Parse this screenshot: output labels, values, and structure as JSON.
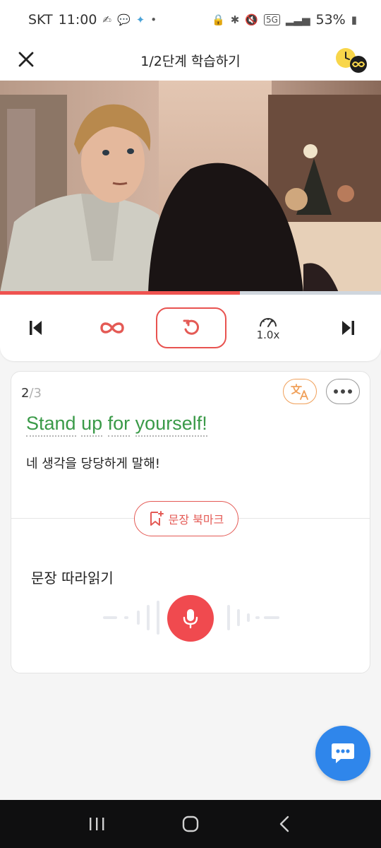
{
  "status_bar": {
    "carrier": "SKT",
    "time": "11:00",
    "battery": "53%",
    "network": "5G",
    "left_icons": [
      "hand-icon",
      "chat-bubble-icon",
      "sparkle-icon",
      "dot-icon"
    ],
    "right_icons": [
      "lock-icon",
      "bluetooth-icon",
      "mute-icon",
      "signal-icon",
      "battery-icon"
    ]
  },
  "header": {
    "title": "1/2단계 학습하기",
    "close_icon": "close-icon",
    "badge_icon": "timer-infinity-icon"
  },
  "video": {
    "progress": 0.63,
    "scene": "two people in an office"
  },
  "controls": {
    "prev_icon": "skip-previous-icon",
    "loop_icon": "infinity-icon",
    "replay_icon": "replay-icon",
    "speed_icon": "speedometer-icon",
    "speed": "1.0x",
    "next_icon": "skip-next-icon"
  },
  "card": {
    "current": "2",
    "separator": "/",
    "total": "3",
    "sentence_words": [
      "Stand",
      "up",
      "for",
      "yourself!"
    ],
    "translation": "네 생각을 당당하게 말해!",
    "bookmark_label": "문장 북마크",
    "shadowing_title": "문장 따라읽기"
  },
  "colors": {
    "accent_red": "#e45a55",
    "sentence_green": "#3a9a48",
    "translate_orange": "#f0a05a",
    "fab_blue": "#2f86eb"
  },
  "navbar": {
    "icons": [
      "recent-apps-icon",
      "home-icon",
      "back-icon"
    ]
  }
}
